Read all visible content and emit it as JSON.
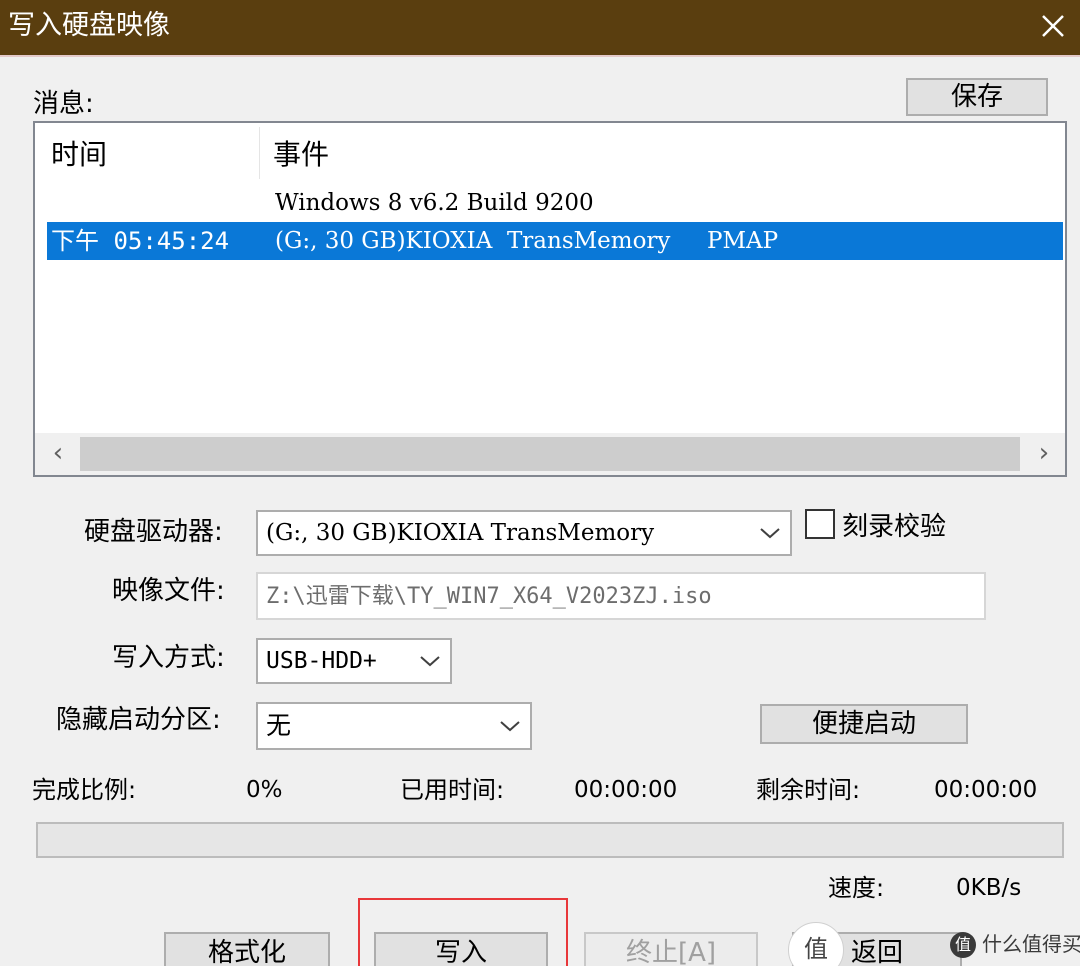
{
  "window": {
    "title": "写入硬盘映像",
    "close_icon": "close-icon"
  },
  "messages": {
    "label": "消息:",
    "save_button": "保存",
    "columns": [
      "时间",
      "事件"
    ],
    "rows": [
      {
        "time": "",
        "event": "Windows 8 v6.2 Build 9200",
        "selected": false
      },
      {
        "time": "下午 05:45:24",
        "event": "(G:, 30 GB)KIOXIA  TransMemory     PMAP",
        "selected": true
      }
    ],
    "scroll_left_icon": "chevron-left-icon",
    "scroll_right_icon": "chevron-right-icon"
  },
  "form": {
    "drive_label": "硬盘驱动器:",
    "drive_value": "(G:, 30 GB)KIOXIA  TransMemory",
    "verify_label": "刻录校验",
    "verify_checked": false,
    "image_label": "映像文件:",
    "image_value": "Z:\\迅雷下载\\TY_WIN7_X64_V2023ZJ.iso",
    "mode_label": "写入方式:",
    "mode_value": "USB-HDD+",
    "hidden_label": "隐藏启动分区:",
    "hidden_value": "无",
    "quick_boot_button": "便捷启动"
  },
  "status": {
    "percent_label": "完成比例:",
    "percent_value": "0%",
    "elapsed_label": "已用时间:",
    "elapsed_value": "00:00:00",
    "remaining_label": "剩余时间:",
    "remaining_value": "00:00:00",
    "speed_label": "速度:",
    "speed_value": "0KB/s",
    "progress_fraction": 0
  },
  "buttons": {
    "format": "格式化",
    "write": "写入",
    "stop": "终止[A]",
    "back": "返回"
  },
  "colors": {
    "titlebar": "#5a3e0f",
    "selection": "#0a78d7",
    "highlight_frame": "#e8373a"
  },
  "watermark": {
    "badge": "值",
    "logo": "值",
    "text": "什么值得买"
  }
}
